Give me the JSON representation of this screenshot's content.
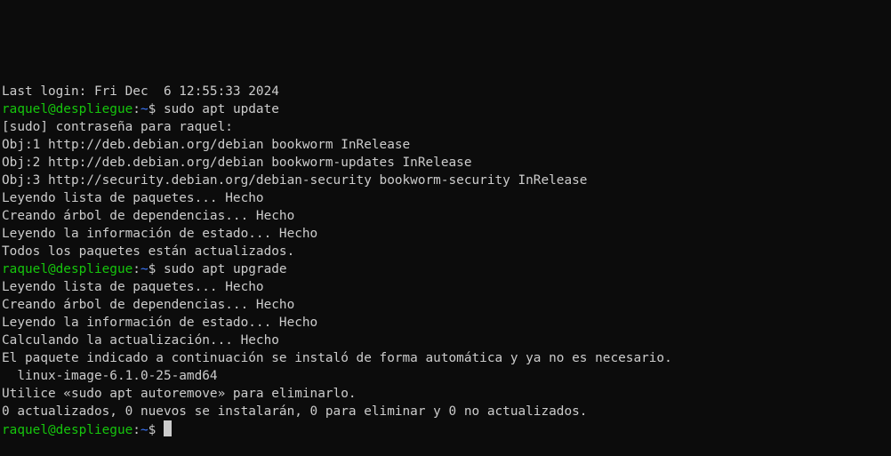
{
  "colors": {
    "background": "#0c0c0c",
    "foreground": "#cccccc",
    "prompt_user": "#16c60c",
    "prompt_path": "#3b78ff"
  },
  "prompt": {
    "user_host": "raquel@despliegue",
    "colon": ":",
    "path": "~",
    "symbol": "$ "
  },
  "lines": [
    {
      "type": "text",
      "text": "Last login: Fri Dec  6 12:55:33 2024"
    },
    {
      "type": "prompt",
      "command": "sudo apt update"
    },
    {
      "type": "text",
      "text": "[sudo] contraseña para raquel:"
    },
    {
      "type": "text",
      "text": "Obj:1 http://deb.debian.org/debian bookworm InRelease"
    },
    {
      "type": "text",
      "text": "Obj:2 http://deb.debian.org/debian bookworm-updates InRelease"
    },
    {
      "type": "text",
      "text": "Obj:3 http://security.debian.org/debian-security bookworm-security InRelease"
    },
    {
      "type": "text",
      "text": "Leyendo lista de paquetes... Hecho"
    },
    {
      "type": "text",
      "text": "Creando árbol de dependencias... Hecho"
    },
    {
      "type": "text",
      "text": "Leyendo la información de estado... Hecho"
    },
    {
      "type": "text",
      "text": "Todos los paquetes están actualizados."
    },
    {
      "type": "prompt",
      "command": "sudo apt upgrade"
    },
    {
      "type": "text",
      "text": "Leyendo lista de paquetes... Hecho"
    },
    {
      "type": "text",
      "text": "Creando árbol de dependencias... Hecho"
    },
    {
      "type": "text",
      "text": "Leyendo la información de estado... Hecho"
    },
    {
      "type": "text",
      "text": "Calculando la actualización... Hecho"
    },
    {
      "type": "text",
      "text": "El paquete indicado a continuación se instaló de forma automática y ya no es necesario."
    },
    {
      "type": "text",
      "text": "  linux-image-6.1.0-25-amd64"
    },
    {
      "type": "text",
      "text": "Utilice «sudo apt autoremove» para eliminarlo."
    },
    {
      "type": "text",
      "text": "0 actualizados, 0 nuevos se instalarán, 0 para eliminar y 0 no actualizados."
    },
    {
      "type": "prompt",
      "command": "",
      "cursor": true
    }
  ]
}
